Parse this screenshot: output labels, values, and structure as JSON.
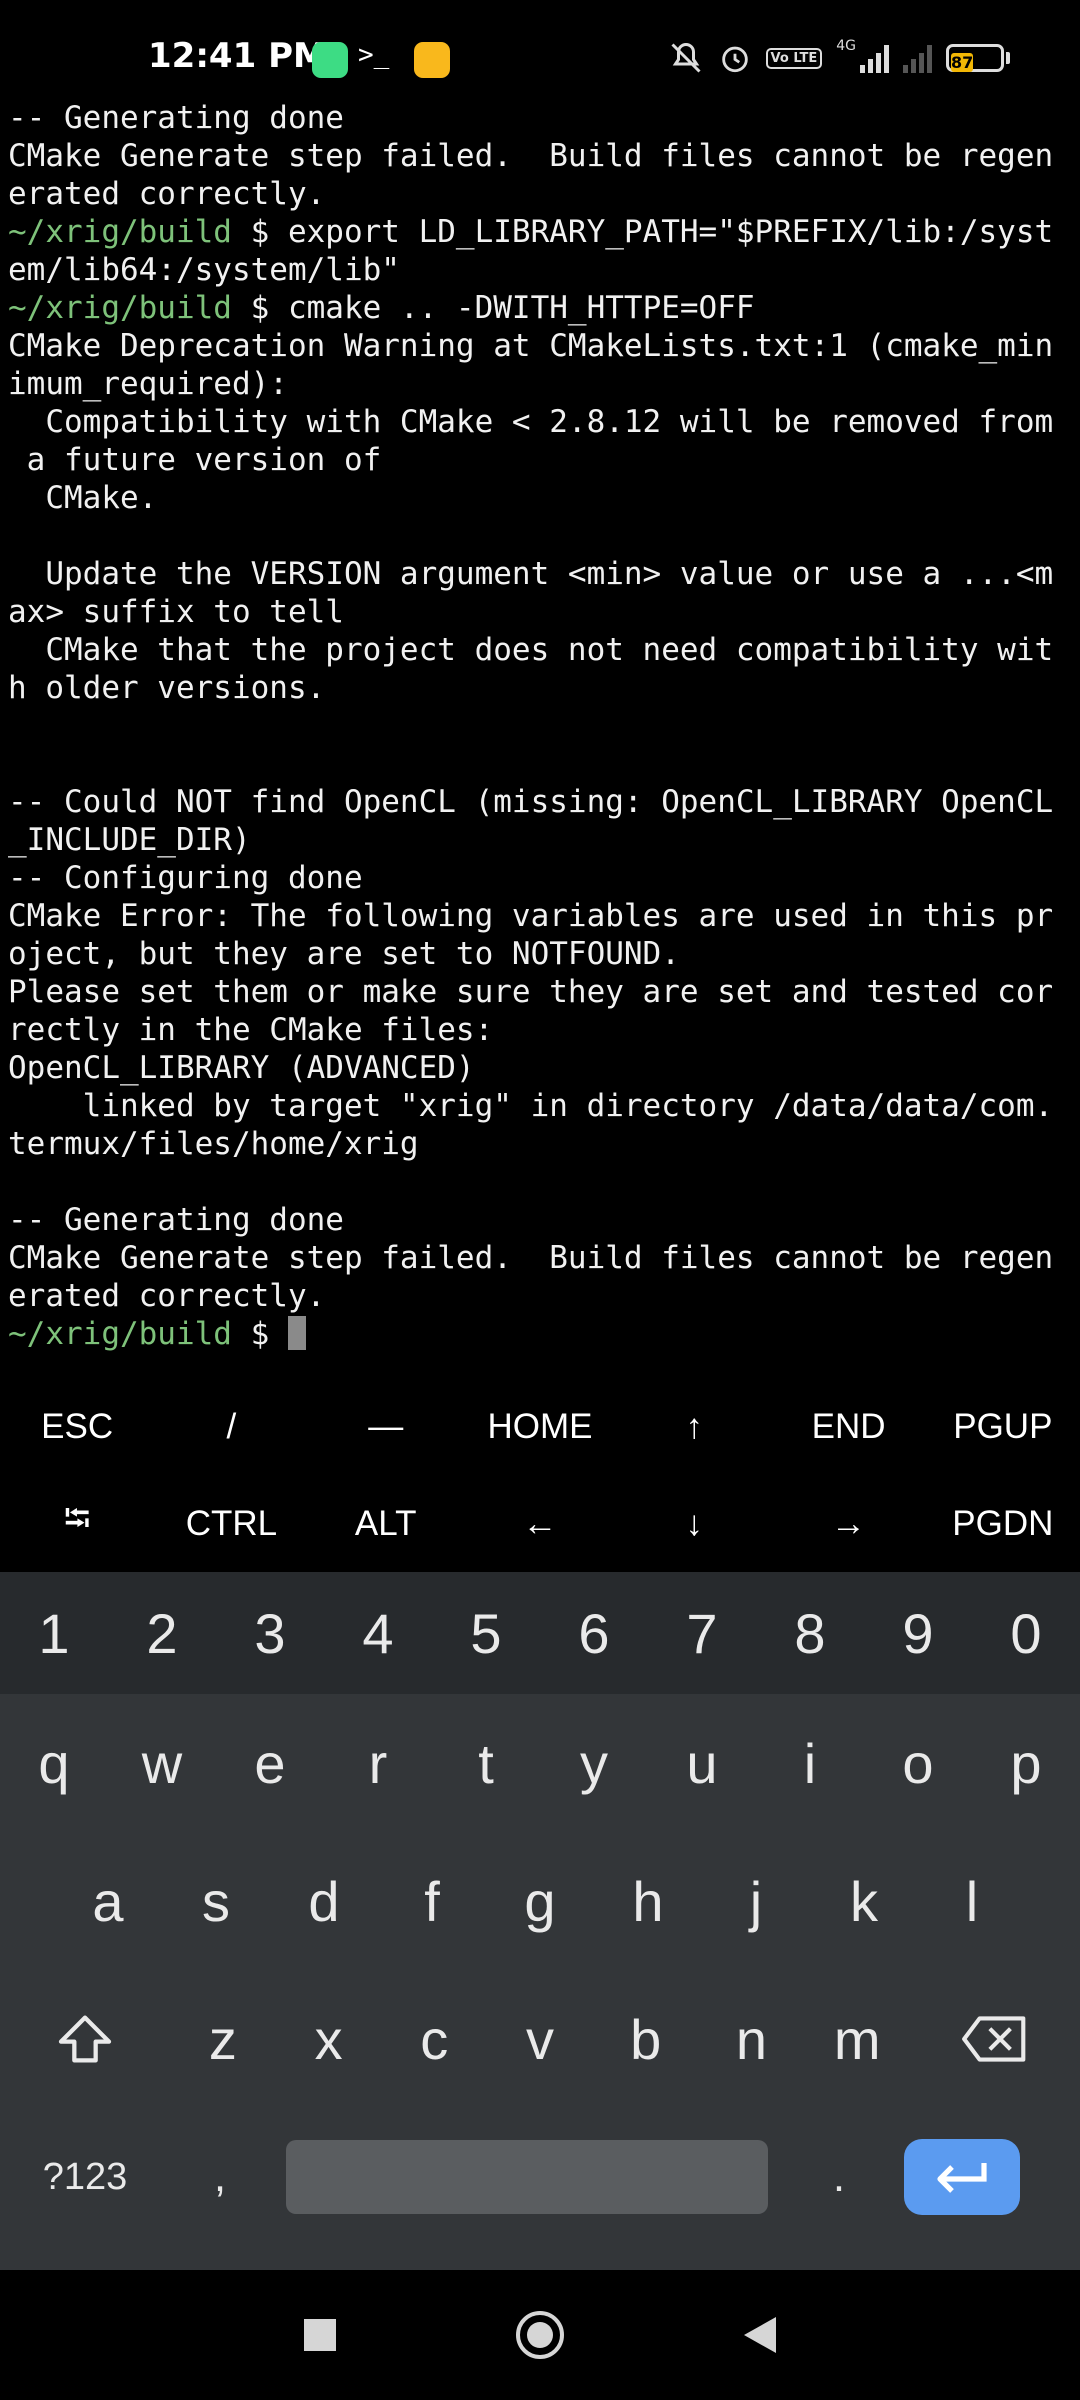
{
  "status_bar": {
    "time": "12:41 PM",
    "term_glyph": ">_",
    "volte": "Vo LTE",
    "network": "4G",
    "battery": "87",
    "icons": [
      "android-icon",
      "terminal-icon",
      "gallery-icon",
      "muted-bell-icon",
      "alarm-icon",
      "volte-icon",
      "signal-icon",
      "signal-icon",
      "battery-icon"
    ]
  },
  "terminal": {
    "lines": [
      {
        "prompt": "",
        "text": "-- Generating done"
      },
      {
        "prompt": "",
        "text": "CMake Generate step failed.  Build files cannot be regen"
      },
      {
        "prompt": "",
        "text": "erated correctly."
      },
      {
        "prompt": "~/xrig/build",
        "text": " $ export LD_LIBRARY_PATH=\"$PREFIX/lib:/syst"
      },
      {
        "prompt": "",
        "text": "em/lib64:/system/lib\""
      },
      {
        "prompt": "~/xrig/build",
        "text": " $ cmake .. -DWITH_HTTPE=OFF"
      },
      {
        "prompt": "",
        "text": "CMake Deprecation Warning at CMakeLists.txt:1 (cmake_min"
      },
      {
        "prompt": "",
        "text": "imum_required):"
      },
      {
        "prompt": "",
        "text": "  Compatibility with CMake < 2.8.12 will be removed from"
      },
      {
        "prompt": "",
        "text": " a future version of"
      },
      {
        "prompt": "",
        "text": "  CMake."
      },
      {
        "prompt": "",
        "text": ""
      },
      {
        "prompt": "",
        "text": "  Update the VERSION argument <min> value or use a ...<m"
      },
      {
        "prompt": "",
        "text": "ax> suffix to tell"
      },
      {
        "prompt": "",
        "text": "  CMake that the project does not need compatibility wit"
      },
      {
        "prompt": "",
        "text": "h older versions."
      },
      {
        "prompt": "",
        "text": ""
      },
      {
        "prompt": "",
        "text": ""
      },
      {
        "prompt": "",
        "text": "-- Could NOT find OpenCL (missing: OpenCL_LIBRARY OpenCL"
      },
      {
        "prompt": "",
        "text": "_INCLUDE_DIR)"
      },
      {
        "prompt": "",
        "text": "-- Configuring done"
      },
      {
        "prompt": "",
        "text": "CMake Error: The following variables are used in this pr"
      },
      {
        "prompt": "",
        "text": "oject, but they are set to NOTFOUND."
      },
      {
        "prompt": "",
        "text": "Please set them or make sure they are set and tested cor"
      },
      {
        "prompt": "",
        "text": "rectly in the CMake files:"
      },
      {
        "prompt": "",
        "text": "OpenCL_LIBRARY (ADVANCED)"
      },
      {
        "prompt": "",
        "text": "    linked by target \"xrig\" in directory /data/data/com."
      },
      {
        "prompt": "",
        "text": "termux/files/home/xrig"
      },
      {
        "prompt": "",
        "text": ""
      },
      {
        "prompt": "",
        "text": "-- Generating done"
      },
      {
        "prompt": "",
        "text": "CMake Generate step failed.  Build files cannot be regen"
      },
      {
        "prompt": "",
        "text": "erated correctly."
      }
    ],
    "current_prompt": "~/xrig/build",
    "current_suffix": " $ "
  },
  "extra_keys": {
    "row1": [
      "ESC",
      "/",
      "—",
      "HOME",
      "↑",
      "END",
      "PGUP"
    ],
    "row2": [
      "⭾",
      "CTRL",
      "ALT",
      "←",
      "↓",
      "→",
      "PGDN"
    ]
  },
  "keyboard": {
    "numbers": [
      "1",
      "2",
      "3",
      "4",
      "5",
      "6",
      "7",
      "8",
      "9",
      "0"
    ],
    "row1": [
      "q",
      "w",
      "e",
      "r",
      "t",
      "y",
      "u",
      "i",
      "o",
      "p"
    ],
    "row2": [
      "a",
      "s",
      "d",
      "f",
      "g",
      "h",
      "j",
      "k",
      "l"
    ],
    "row3": [
      "z",
      "x",
      "c",
      "v",
      "b",
      "n",
      "m"
    ],
    "symbols_label": "?123",
    "comma": ",",
    "period": "."
  },
  "colors": {
    "prompt": "#7ec27a",
    "keyboard_bg": "#333639",
    "enter_key": "#5b9bf0"
  }
}
